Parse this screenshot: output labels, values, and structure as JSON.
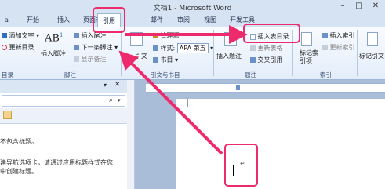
{
  "window": {
    "title": "文档1 - Microsoft Word",
    "controls": [
      "–",
      "□",
      "✕"
    ]
  },
  "tabs": [
    {
      "label": "a"
    },
    {
      "label": "开始"
    },
    {
      "label": "插入"
    },
    {
      "label": "页面布局"
    },
    {
      "label": "引用",
      "active": true
    },
    {
      "label": "邮件"
    },
    {
      "label": "审阅"
    },
    {
      "label": "视图"
    },
    {
      "label": "开发工具"
    }
  ],
  "ribbon": {
    "toc": {
      "add_text": "添加文字",
      "update_toc": "更新目录",
      "group_label": "目录"
    },
    "footnotes": {
      "insert_footnote": "插入脚注",
      "insert_endnote": "插入尾注",
      "next_footnote": "下一条脚注",
      "show_notes": "显示备注",
      "group_label": "脚注",
      "ab_icon": "AB",
      "ab_sup": "1"
    },
    "citations": {
      "insert_citation": "引文",
      "manage_sources": "管理源",
      "style_label": "样式:",
      "style_value": "APA 第五",
      "bibliography": "书目",
      "group_label": "引文与书目"
    },
    "captions": {
      "insert_caption": "插入题注",
      "insert_table_of_figures": "插入表目录",
      "update_table": "更新表格",
      "cross_reference": "交叉引用",
      "group_label": "题注"
    },
    "index": {
      "mark_entry": "标记索引项",
      "insert_index": "插入索引",
      "update_index": "更新索引",
      "group_label": "索引"
    },
    "toa": {
      "mark_citation": "标记引文"
    }
  },
  "nav_pane": {
    "line1": "不包含标题。",
    "line2": "建导航选项卡，请通过应用标题样式在您",
    "line3": "中创建标题。"
  },
  "highlight_color": "#ec2a6c",
  "icons": [
    "document-icon",
    "footnote-icon",
    "citation-icon",
    "caption-icon",
    "table-of-figures-icon",
    "search-icon",
    "close-icon"
  ]
}
